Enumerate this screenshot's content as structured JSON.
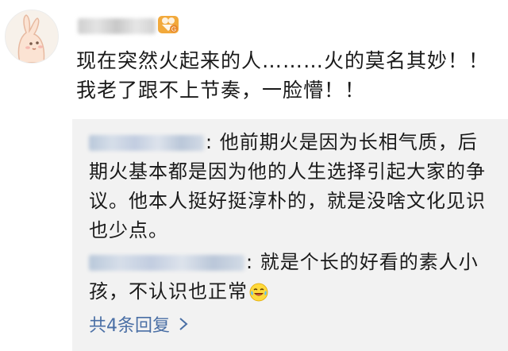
{
  "post": {
    "lines": [
      "现在突然火起来的人………火的莫名其妙！！",
      "我老了跟不上节奏，一脸懵！！"
    ]
  },
  "replies": [
    {
      "lines": [
        ": 他前期火是因为长相气质，后",
        "期火基本都是因为他的人生选择引起大家的争",
        "议。他本人挺好挺淳朴的，就是没啥文化见识",
        "也少点。"
      ]
    },
    {
      "lines": [
        ": 就是个长的好看的素人小",
        "孩，不认识也正常"
      ],
      "emoji": "crying-laughing-emoji"
    }
  ],
  "more_replies_label": "共4条回复",
  "icons": {
    "badge": "fan-level-badge-icon",
    "chevron": "chevron-right-icon"
  },
  "colors": {
    "link": "#4a6fa5",
    "reply_bg": "#f2f2f2",
    "badge": "#f2a93b"
  }
}
